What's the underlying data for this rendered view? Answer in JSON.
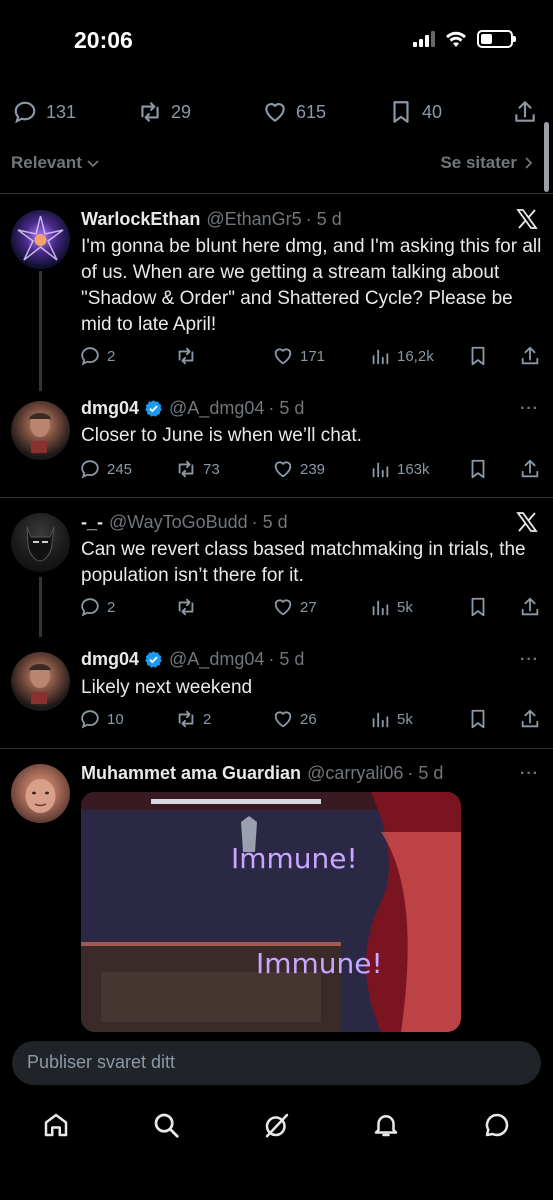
{
  "status": {
    "time": "20:06"
  },
  "tweet_stats": {
    "replies": "131",
    "reposts": "29",
    "likes": "615",
    "bookmarks": "40"
  },
  "sort": {
    "left_label": "Relevant",
    "right_label": "Se sitater"
  },
  "posts": [
    {
      "name": "WarlockEthan",
      "handle": "@EthanGr5",
      "time": "· 5 d",
      "text": "I'm gonna be blunt here dmg, and I'm asking this for all of us. When are we getting a stream talking about \"Shadow & Order\" and Shattered Cycle? Please be mid to late April!",
      "replies": "2",
      "reposts": "",
      "likes": "171",
      "views": "16,2k"
    },
    {
      "name": "dmg04",
      "handle": "@A_dmg04",
      "time": "· 5 d",
      "text": "Closer to June is when we’ll chat.",
      "replies": "245",
      "reposts": "73",
      "likes": "239",
      "views": "163k"
    },
    {
      "name": "-_-",
      "handle": "@WayToGoBudd",
      "time": "· 5 d",
      "text": "Can we revert class based matchmaking in trials, the population isn’t there for it.",
      "replies": "2",
      "reposts": "",
      "likes": "27",
      "views": "5k"
    },
    {
      "name": "dmg04",
      "handle": "@A_dmg04",
      "time": "· 5 d",
      "text": "Likely next weekend",
      "replies": "10",
      "reposts": "2",
      "likes": "26",
      "views": "5k"
    },
    {
      "name": "Muhammet ama Guardian",
      "handle": "@carryali06",
      "time": "· 5 d",
      "media_texts": [
        "Immune!",
        "Immune!"
      ]
    }
  ],
  "reply": {
    "placeholder": "Publiser svaret ditt"
  },
  "colors": {
    "background": "#000000",
    "muted": "#71767b",
    "verified": "#1d9bf0"
  }
}
